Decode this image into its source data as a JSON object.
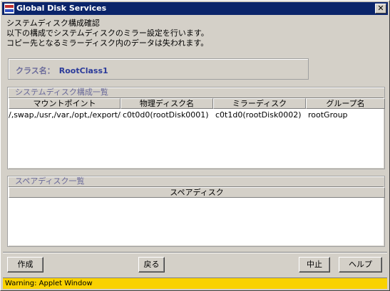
{
  "window": {
    "title": "Global Disk Services",
    "close_label": "✕"
  },
  "messages": [
    "システムディスク構成確認",
    "以下の構成でシステムディスクのミラー設定を行います。",
    "コピー先となるミラーディスク内のデータは失われます。"
  ],
  "class_info": {
    "label": "クラス名：",
    "value": "RootClass1"
  },
  "system_disk_table": {
    "title": "システムディスク構成一覧",
    "columns": [
      "マウントポイント",
      "物理ディスク名",
      "ミラーディスク",
      "グループ名"
    ],
    "rows": [
      [
        "/,swap,/usr,/var,/opt,/export/ho...",
        "c0t0d0(rootDisk0001)",
        "c0t1d0(rootDisk0002)",
        "rootGroup"
      ]
    ]
  },
  "spare_disk_table": {
    "title": "スペアディスク一覧",
    "columns": [
      "スペアディスク"
    ]
  },
  "buttons": {
    "create": "作成",
    "back": "戻る",
    "cancel": "中止",
    "help": "ヘルプ"
  },
  "status": {
    "warning": "Warning: Applet Window"
  },
  "colors": {
    "titlebar": "#0a246a",
    "warning_bar": "#f9d200",
    "group_title": "#6a6a9a"
  }
}
